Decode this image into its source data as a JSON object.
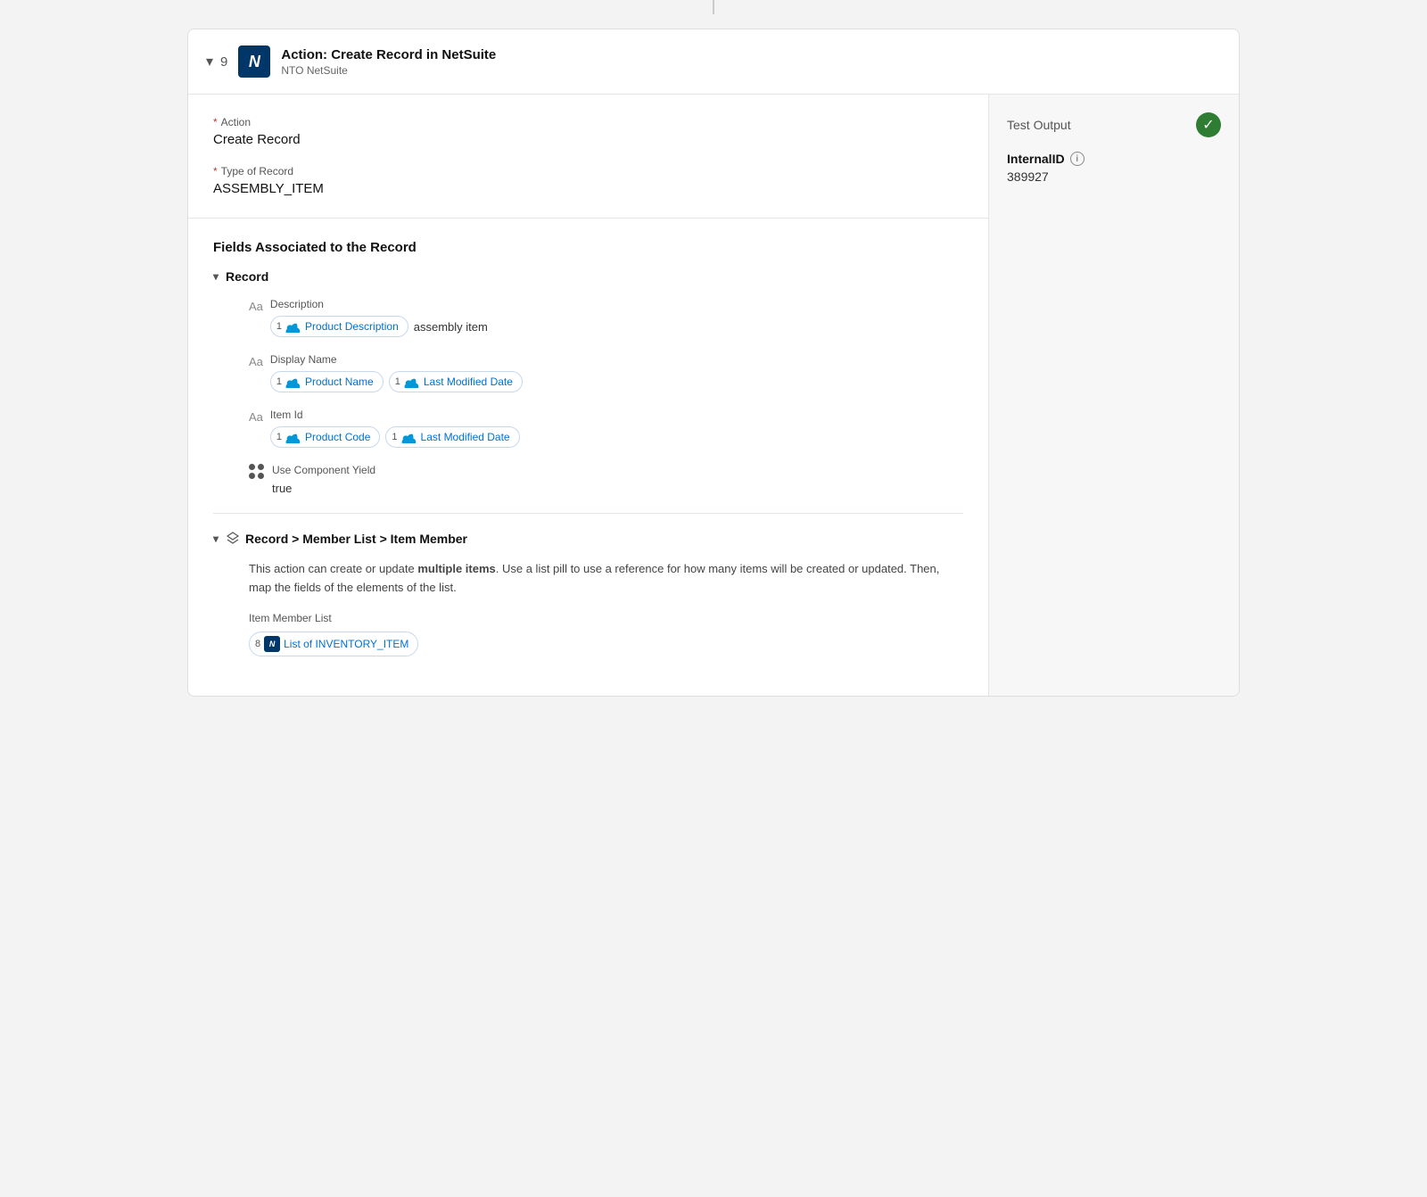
{
  "connector_line": true,
  "header": {
    "chevron": "▾",
    "step_number": "9",
    "title": "Action: Create Record in NetSuite",
    "subtitle": "NTO NetSuite"
  },
  "left_panel": {
    "action_section": {
      "action_label": "Action",
      "action_value": "Create Record",
      "type_label": "Type of Record",
      "type_value": "ASSEMBLY_ITEM"
    },
    "fields_section": {
      "title": "Fields Associated to the Record",
      "record_group": {
        "chevron": "▾",
        "label": "Record",
        "fields": [
          {
            "label": "Description",
            "type_icon": "Aa",
            "pills": [
              {
                "num": "1",
                "text": "Product Description"
              }
            ],
            "plain_text": "assembly item"
          },
          {
            "label": "Display Name",
            "type_icon": "Aa",
            "pills": [
              {
                "num": "1",
                "text": "Product Name"
              },
              {
                "num": "1",
                "text": "Last Modified Date"
              }
            ],
            "plain_text": ""
          },
          {
            "label": "Item Id",
            "type_icon": "Aa",
            "pills": [
              {
                "num": "1",
                "text": "Product Code"
              },
              {
                "num": "1",
                "text": "Last Modified Date"
              }
            ],
            "plain_text": ""
          },
          {
            "label": "Use Component Yield",
            "type_icon": "bool",
            "pills": [],
            "plain_text": "true"
          }
        ]
      },
      "member_list_group": {
        "chevron": "▾",
        "label": "Record > Member List > Item Member",
        "info_text_part1": "This action can create or update ",
        "info_text_bold": "multiple items",
        "info_text_part2": ". Use a list pill to use a reference for how many items will be created or updated. Then, map the fields of the elements of the list.",
        "item_member_list_label": "Item Member List",
        "list_pill": {
          "num": "8",
          "text": "List of INVENTORY_ITEM"
        }
      }
    }
  },
  "right_panel": {
    "title": "Test Output",
    "check_icon": "✓",
    "field_name": "InternalID",
    "field_value": "389927"
  }
}
